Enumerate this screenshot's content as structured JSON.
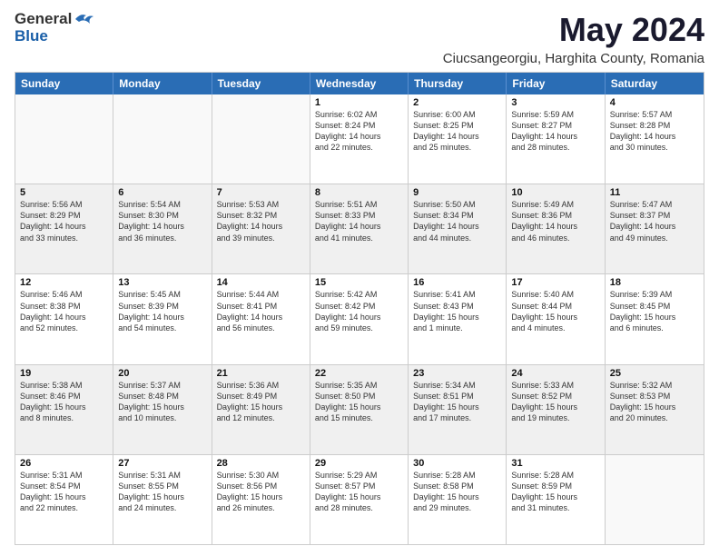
{
  "header": {
    "logo": {
      "general": "General",
      "blue": "Blue"
    },
    "title": "May 2024",
    "location": "Ciucsangeorgiu, Harghita County, Romania"
  },
  "weekdays": [
    "Sunday",
    "Monday",
    "Tuesday",
    "Wednesday",
    "Thursday",
    "Friday",
    "Saturday"
  ],
  "weeks": [
    [
      {
        "day": "",
        "lines": []
      },
      {
        "day": "",
        "lines": []
      },
      {
        "day": "",
        "lines": []
      },
      {
        "day": "1",
        "lines": [
          "Sunrise: 6:02 AM",
          "Sunset: 8:24 PM",
          "Daylight: 14 hours",
          "and 22 minutes."
        ]
      },
      {
        "day": "2",
        "lines": [
          "Sunrise: 6:00 AM",
          "Sunset: 8:25 PM",
          "Daylight: 14 hours",
          "and 25 minutes."
        ]
      },
      {
        "day": "3",
        "lines": [
          "Sunrise: 5:59 AM",
          "Sunset: 8:27 PM",
          "Daylight: 14 hours",
          "and 28 minutes."
        ]
      },
      {
        "day": "4",
        "lines": [
          "Sunrise: 5:57 AM",
          "Sunset: 8:28 PM",
          "Daylight: 14 hours",
          "and 30 minutes."
        ]
      }
    ],
    [
      {
        "day": "5",
        "lines": [
          "Sunrise: 5:56 AM",
          "Sunset: 8:29 PM",
          "Daylight: 14 hours",
          "and 33 minutes."
        ]
      },
      {
        "day": "6",
        "lines": [
          "Sunrise: 5:54 AM",
          "Sunset: 8:30 PM",
          "Daylight: 14 hours",
          "and 36 minutes."
        ]
      },
      {
        "day": "7",
        "lines": [
          "Sunrise: 5:53 AM",
          "Sunset: 8:32 PM",
          "Daylight: 14 hours",
          "and 39 minutes."
        ]
      },
      {
        "day": "8",
        "lines": [
          "Sunrise: 5:51 AM",
          "Sunset: 8:33 PM",
          "Daylight: 14 hours",
          "and 41 minutes."
        ]
      },
      {
        "day": "9",
        "lines": [
          "Sunrise: 5:50 AM",
          "Sunset: 8:34 PM",
          "Daylight: 14 hours",
          "and 44 minutes."
        ]
      },
      {
        "day": "10",
        "lines": [
          "Sunrise: 5:49 AM",
          "Sunset: 8:36 PM",
          "Daylight: 14 hours",
          "and 46 minutes."
        ]
      },
      {
        "day": "11",
        "lines": [
          "Sunrise: 5:47 AM",
          "Sunset: 8:37 PM",
          "Daylight: 14 hours",
          "and 49 minutes."
        ]
      }
    ],
    [
      {
        "day": "12",
        "lines": [
          "Sunrise: 5:46 AM",
          "Sunset: 8:38 PM",
          "Daylight: 14 hours",
          "and 52 minutes."
        ]
      },
      {
        "day": "13",
        "lines": [
          "Sunrise: 5:45 AM",
          "Sunset: 8:39 PM",
          "Daylight: 14 hours",
          "and 54 minutes."
        ]
      },
      {
        "day": "14",
        "lines": [
          "Sunrise: 5:44 AM",
          "Sunset: 8:41 PM",
          "Daylight: 14 hours",
          "and 56 minutes."
        ]
      },
      {
        "day": "15",
        "lines": [
          "Sunrise: 5:42 AM",
          "Sunset: 8:42 PM",
          "Daylight: 14 hours",
          "and 59 minutes."
        ]
      },
      {
        "day": "16",
        "lines": [
          "Sunrise: 5:41 AM",
          "Sunset: 8:43 PM",
          "Daylight: 15 hours",
          "and 1 minute."
        ]
      },
      {
        "day": "17",
        "lines": [
          "Sunrise: 5:40 AM",
          "Sunset: 8:44 PM",
          "Daylight: 15 hours",
          "and 4 minutes."
        ]
      },
      {
        "day": "18",
        "lines": [
          "Sunrise: 5:39 AM",
          "Sunset: 8:45 PM",
          "Daylight: 15 hours",
          "and 6 minutes."
        ]
      }
    ],
    [
      {
        "day": "19",
        "lines": [
          "Sunrise: 5:38 AM",
          "Sunset: 8:46 PM",
          "Daylight: 15 hours",
          "and 8 minutes."
        ]
      },
      {
        "day": "20",
        "lines": [
          "Sunrise: 5:37 AM",
          "Sunset: 8:48 PM",
          "Daylight: 15 hours",
          "and 10 minutes."
        ]
      },
      {
        "day": "21",
        "lines": [
          "Sunrise: 5:36 AM",
          "Sunset: 8:49 PM",
          "Daylight: 15 hours",
          "and 12 minutes."
        ]
      },
      {
        "day": "22",
        "lines": [
          "Sunrise: 5:35 AM",
          "Sunset: 8:50 PM",
          "Daylight: 15 hours",
          "and 15 minutes."
        ]
      },
      {
        "day": "23",
        "lines": [
          "Sunrise: 5:34 AM",
          "Sunset: 8:51 PM",
          "Daylight: 15 hours",
          "and 17 minutes."
        ]
      },
      {
        "day": "24",
        "lines": [
          "Sunrise: 5:33 AM",
          "Sunset: 8:52 PM",
          "Daylight: 15 hours",
          "and 19 minutes."
        ]
      },
      {
        "day": "25",
        "lines": [
          "Sunrise: 5:32 AM",
          "Sunset: 8:53 PM",
          "Daylight: 15 hours",
          "and 20 minutes."
        ]
      }
    ],
    [
      {
        "day": "26",
        "lines": [
          "Sunrise: 5:31 AM",
          "Sunset: 8:54 PM",
          "Daylight: 15 hours",
          "and 22 minutes."
        ]
      },
      {
        "day": "27",
        "lines": [
          "Sunrise: 5:31 AM",
          "Sunset: 8:55 PM",
          "Daylight: 15 hours",
          "and 24 minutes."
        ]
      },
      {
        "day": "28",
        "lines": [
          "Sunrise: 5:30 AM",
          "Sunset: 8:56 PM",
          "Daylight: 15 hours",
          "and 26 minutes."
        ]
      },
      {
        "day": "29",
        "lines": [
          "Sunrise: 5:29 AM",
          "Sunset: 8:57 PM",
          "Daylight: 15 hours",
          "and 28 minutes."
        ]
      },
      {
        "day": "30",
        "lines": [
          "Sunrise: 5:28 AM",
          "Sunset: 8:58 PM",
          "Daylight: 15 hours",
          "and 29 minutes."
        ]
      },
      {
        "day": "31",
        "lines": [
          "Sunrise: 5:28 AM",
          "Sunset: 8:59 PM",
          "Daylight: 15 hours",
          "and 31 minutes."
        ]
      },
      {
        "day": "",
        "lines": []
      }
    ]
  ]
}
